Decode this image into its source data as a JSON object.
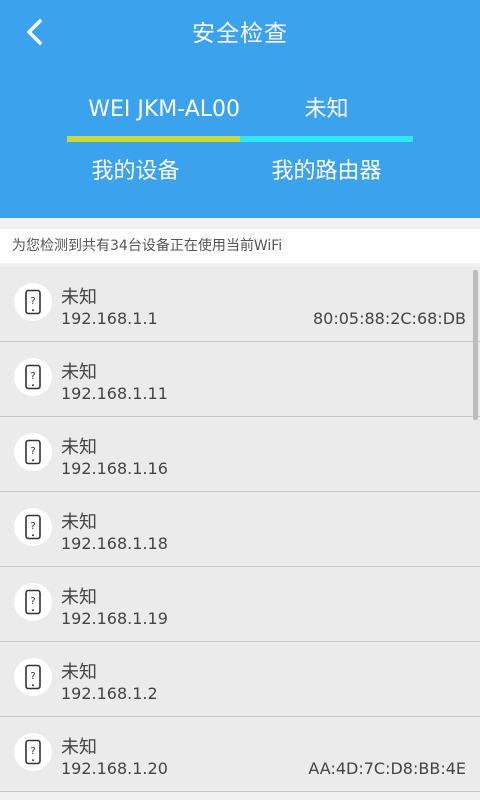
{
  "header": {
    "title": "安全检查",
    "compare_left": "WEI JKM-AL00",
    "compare_right": "未知",
    "tab_left": "我的设备",
    "tab_right": "我的路由器",
    "colors": {
      "background": "#3ba2ee",
      "left_bar": "#c9d83c",
      "right_bar": "#2ee6f4"
    }
  },
  "notice": {
    "text": "为您检测到共有34台设备正在使用当前WiFi"
  },
  "devices": [
    {
      "name": "未知",
      "ip": "192.168.1.1",
      "mac": "80:05:88:2C:68:DB"
    },
    {
      "name": "未知",
      "ip": "192.168.1.11",
      "mac": ""
    },
    {
      "name": "未知",
      "ip": "192.168.1.16",
      "mac": ""
    },
    {
      "name": "未知",
      "ip": "192.168.1.18",
      "mac": ""
    },
    {
      "name": "未知",
      "ip": "192.168.1.19",
      "mac": ""
    },
    {
      "name": "未知",
      "ip": "192.168.1.2",
      "mac": ""
    },
    {
      "name": "未知",
      "ip": "192.168.1.20",
      "mac": "AA:4D:7C:D8:BB:4E"
    }
  ],
  "icons": {
    "back": "chevron-left-icon",
    "device": "unknown-phone-icon"
  }
}
